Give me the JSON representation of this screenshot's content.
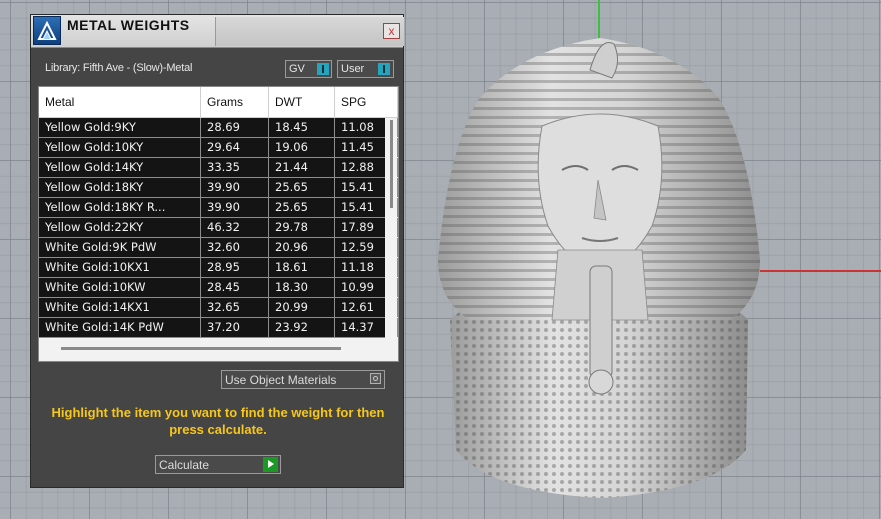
{
  "window": {
    "title": "METAL WEIGHTS",
    "close_glyph": "x"
  },
  "library": {
    "label": "Library: Fifth Ave - (Slow)-Metal"
  },
  "toggles": {
    "gv_label": "GV",
    "user_label": "User"
  },
  "table": {
    "columns": [
      "Metal",
      "Grams",
      "DWT",
      "SPG"
    ],
    "rows": [
      [
        "Yellow Gold:9KY",
        "28.69",
        "18.45",
        "11.08"
      ],
      [
        "Yellow Gold:10KY",
        "29.64",
        "19.06",
        "11.45"
      ],
      [
        "Yellow Gold:14KY",
        "33.35",
        "21.44",
        "12.88"
      ],
      [
        "Yellow Gold:18KY",
        "39.90",
        "25.65",
        "15.41"
      ],
      [
        "Yellow Gold:18KY R...",
        "39.90",
        "25.65",
        "15.41"
      ],
      [
        "Yellow Gold:22KY",
        "46.32",
        "29.78",
        "17.89"
      ],
      [
        "White Gold:9K PdW",
        "32.60",
        "20.96",
        "12.59"
      ],
      [
        "White Gold:10KX1",
        "28.95",
        "18.61",
        "11.18"
      ],
      [
        "White Gold:10KW",
        "28.45",
        "18.30",
        "10.99"
      ],
      [
        "White Gold:14KX1",
        "32.65",
        "20.99",
        "12.61"
      ],
      [
        "White Gold:14K PdW",
        "37.20",
        "23.92",
        "14.37"
      ]
    ]
  },
  "options": {
    "use_object_materials": "Use Object Materials"
  },
  "hint": "Highlight the item you want to find the weight for then press calculate.",
  "actions": {
    "calculate_label": "Calculate"
  },
  "icons": {
    "logo": "metal-weights-logo-icon",
    "play": "play-arrow-icon"
  },
  "colors": {
    "hint": "#f6c71b",
    "toggle_on": "#27a4bd",
    "calculate_button": "#1a9a25",
    "x_axis": "#cc3333",
    "y_axis": "#3fbf3f"
  }
}
